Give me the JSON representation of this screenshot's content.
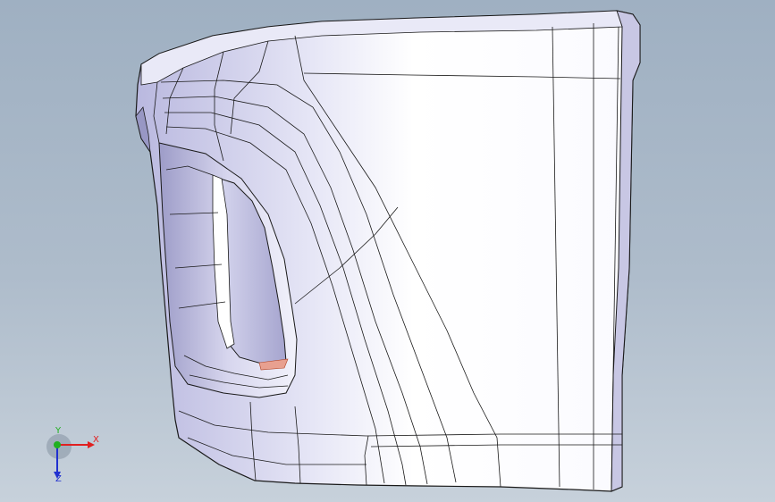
{
  "viewport": {
    "background_top": "#9fb0c2",
    "background_bottom": "#c7d1db",
    "model_color": "#ffffff",
    "model_shade": "#c9c8e6",
    "edge_color": "#1a1a1a"
  },
  "triad": {
    "x_label": "X",
    "y_label": "Y",
    "z_label": "Z",
    "x_color": "#e02020",
    "y_color": "#20b020",
    "z_color": "#2030d0"
  }
}
